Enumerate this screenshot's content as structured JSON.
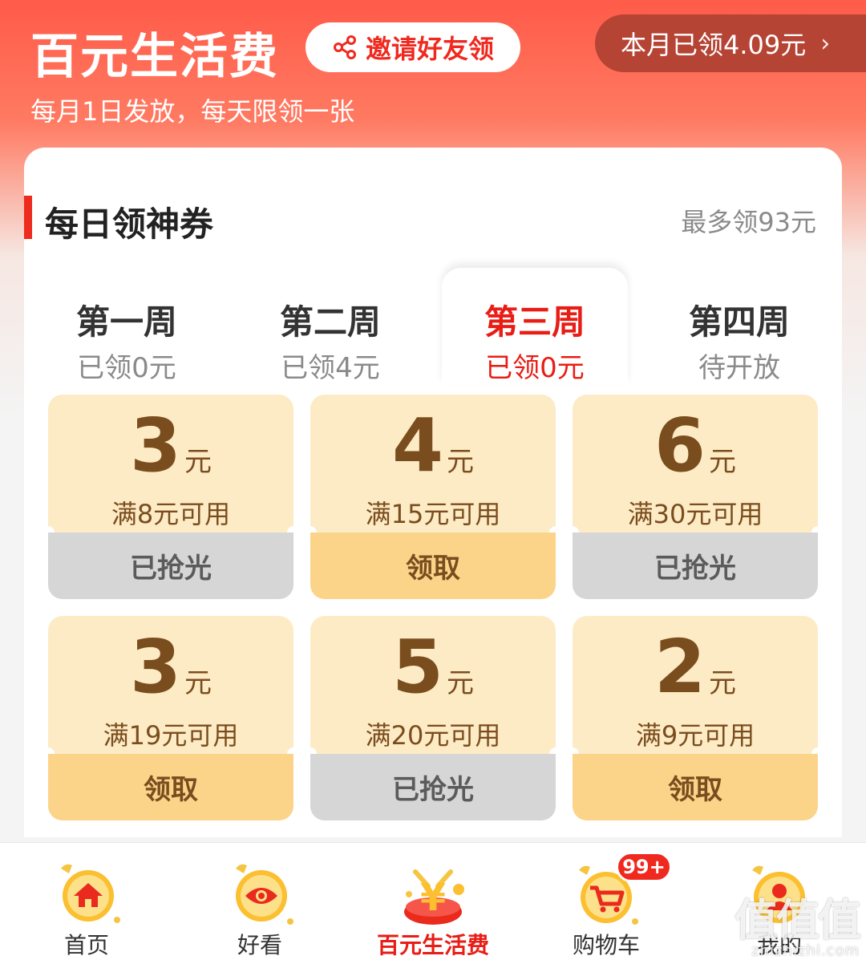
{
  "header": {
    "title": "百元生活费",
    "invite_label": "邀请好友领",
    "monthly_claimed": "本月已领4.09元",
    "subtitle": "每月1日发放，每天限领一张"
  },
  "section": {
    "title": "每日领神券",
    "note": "最多领93元"
  },
  "weeks": [
    {
      "name": "第一周",
      "amount": "已领0元"
    },
    {
      "name": "第二周",
      "amount": "已领4元"
    },
    {
      "name": "第三周",
      "amount": "已领0元"
    },
    {
      "name": "第四周",
      "amount": "待开放"
    }
  ],
  "coupons": [
    {
      "value": "3",
      "unit": "元",
      "condition": "满8元可用",
      "action": "已抢光"
    },
    {
      "value": "4",
      "unit": "元",
      "condition": "满15元可用",
      "action": "领取"
    },
    {
      "value": "6",
      "unit": "元",
      "condition": "满30元可用",
      "action": "已抢光"
    },
    {
      "value": "3",
      "unit": "元",
      "condition": "满19元可用",
      "action": "领取"
    },
    {
      "value": "5",
      "unit": "元",
      "condition": "满20元可用",
      "action": "已抢光"
    },
    {
      "value": "2",
      "unit": "元",
      "condition": "满9元可用",
      "action": "领取"
    }
  ],
  "tabbar": {
    "items": [
      {
        "label": "首页"
      },
      {
        "label": "好看"
      },
      {
        "label": "百元生活费"
      },
      {
        "label": "购物车"
      },
      {
        "label": "我的"
      }
    ],
    "cart_badge": "99+"
  },
  "watermark": {
    "text": "值值值",
    "url": "zhizhizhi.com"
  },
  "colors": {
    "brand_red": "#e81d15",
    "coupon_bg": "#fdebc6",
    "claim_bg": "#fbd48a",
    "soldout_bg": "#d6d6d6",
    "coupon_text": "#7a4d1e"
  }
}
